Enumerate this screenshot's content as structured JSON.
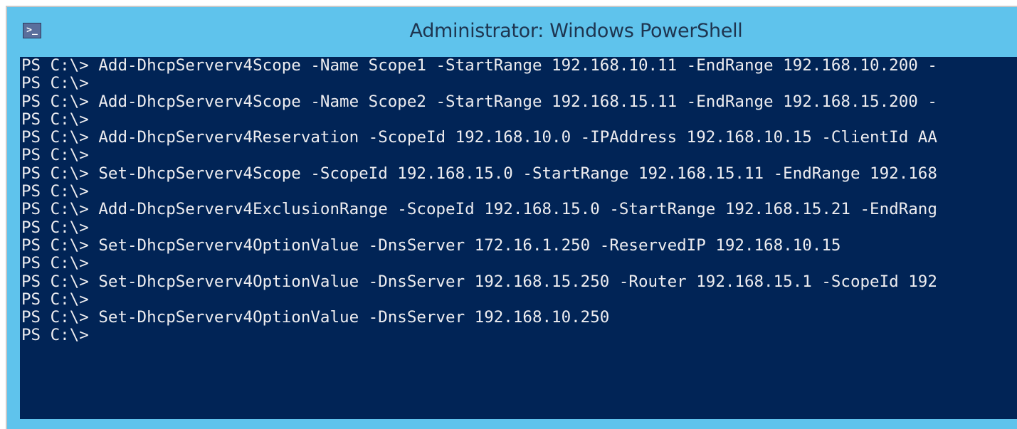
{
  "window": {
    "title": "Administrator: Windows PowerShell",
    "icon": "powershell-icon"
  },
  "console": {
    "lines": [
      "PS C:\\> Add-DhcpServerv4Scope -Name Scope1 -StartRange 192.168.10.11 -EndRange 192.168.10.200 -",
      "PS C:\\>",
      "PS C:\\> Add-DhcpServerv4Scope -Name Scope2 -StartRange 192.168.15.11 -EndRange 192.168.15.200 -",
      "PS C:\\>",
      "PS C:\\> Add-DhcpServerv4Reservation -ScopeId 192.168.10.0 -IPAddress 192.168.10.15 -ClientId AA",
      "PS C:\\>",
      "PS C:\\> Set-DhcpServerv4Scope -ScopeId 192.168.15.0 -StartRange 192.168.15.11 -EndRange 192.168",
      "PS C:\\>",
      "PS C:\\> Add-DhcpServerv4ExclusionRange -ScopeId 192.168.15.0 -StartRange 192.168.15.21 -EndRang",
      "PS C:\\>",
      "PS C:\\> Set-DhcpServerv4OptionValue -DnsServer 172.16.1.250 -ReservedIP 192.168.10.15",
      "PS C:\\>",
      "PS C:\\> Set-DhcpServerv4OptionValue -DnsServer 192.168.15.250 -Router 192.168.15.1 -ScopeId 192",
      "PS C:\\>",
      "PS C:\\> Set-DhcpServerv4OptionValue -DnsServer 192.168.10.250",
      "PS C:\\>"
    ]
  }
}
